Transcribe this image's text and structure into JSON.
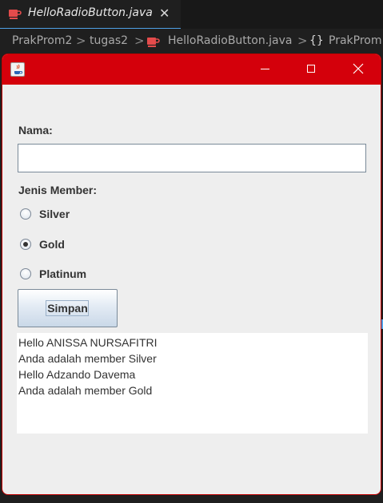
{
  "editor": {
    "tab": {
      "title": "HelloRadioButton.java",
      "icon": "java-file-icon",
      "close_glyph": "✕"
    },
    "breadcrumb": {
      "items": [
        "PrakProm2",
        "tugas2",
        "HelloRadioButton.java",
        "PrakProm"
      ],
      "separator": ">",
      "braces": "{}"
    }
  },
  "window": {
    "title": "",
    "titlebar_color": "#d4000b",
    "icon": "java-app-icon",
    "controls": [
      "minimize",
      "maximize",
      "close"
    ]
  },
  "form": {
    "name_label": "Nama:",
    "name_value": "",
    "member_label": "Jenis Member:",
    "options": [
      {
        "label": "Silver",
        "selected": false
      },
      {
        "label": "Gold",
        "selected": true
      },
      {
        "label": "Platinum",
        "selected": false
      }
    ],
    "save_label": "Simpan"
  },
  "output": {
    "lines": [
      "Hello ANISSA NURSAFITRI",
      "Anda adalah member Silver",
      "Hello Adzando Davema",
      "Anda adalah member Gold"
    ]
  }
}
